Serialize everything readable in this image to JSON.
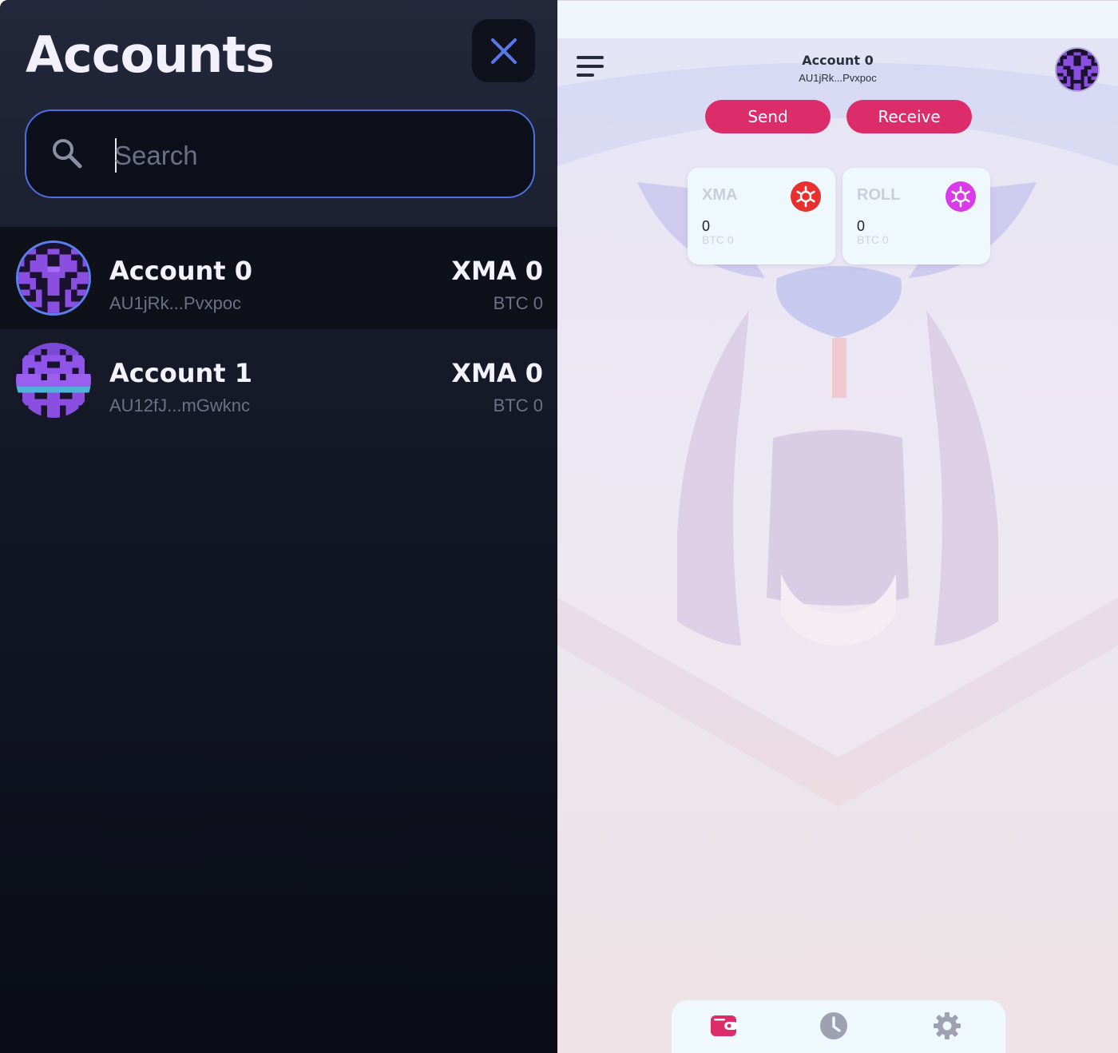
{
  "drawer": {
    "title": "Accounts",
    "search": {
      "placeholder": "Search",
      "value": ""
    },
    "accounts": [
      {
        "name": "Account 0",
        "address": "AU1jRk...Pvxpoc",
        "balance": "XMA 0",
        "btc": "BTC 0",
        "selected": true
      },
      {
        "name": "Account 1",
        "address": "AU12fJ...mGwknc",
        "balance": "XMA 0",
        "btc": "BTC 0",
        "selected": false
      }
    ]
  },
  "wallet": {
    "header": {
      "account_name": "Account 0",
      "address": "AU1jRk...Pvxpoc"
    },
    "actions": {
      "send": "Send",
      "receive": "Receive"
    },
    "tokens": [
      {
        "symbol": "XMA",
        "amount": "0",
        "btc": "BTC 0",
        "logo_color": "#e8312e"
      },
      {
        "symbol": "ROLL",
        "amount": "0",
        "btc": "BTC 0",
        "logo_color": "#d93be8"
      }
    ],
    "nav": [
      {
        "name": "wallet-icon",
        "active": true
      },
      {
        "name": "clock-icon",
        "active": false
      },
      {
        "name": "gear-icon",
        "active": false
      }
    ]
  },
  "colors": {
    "accent": "#dc2d6a",
    "drawer_bg": "#141826",
    "search_border": "#4d6fe0"
  }
}
